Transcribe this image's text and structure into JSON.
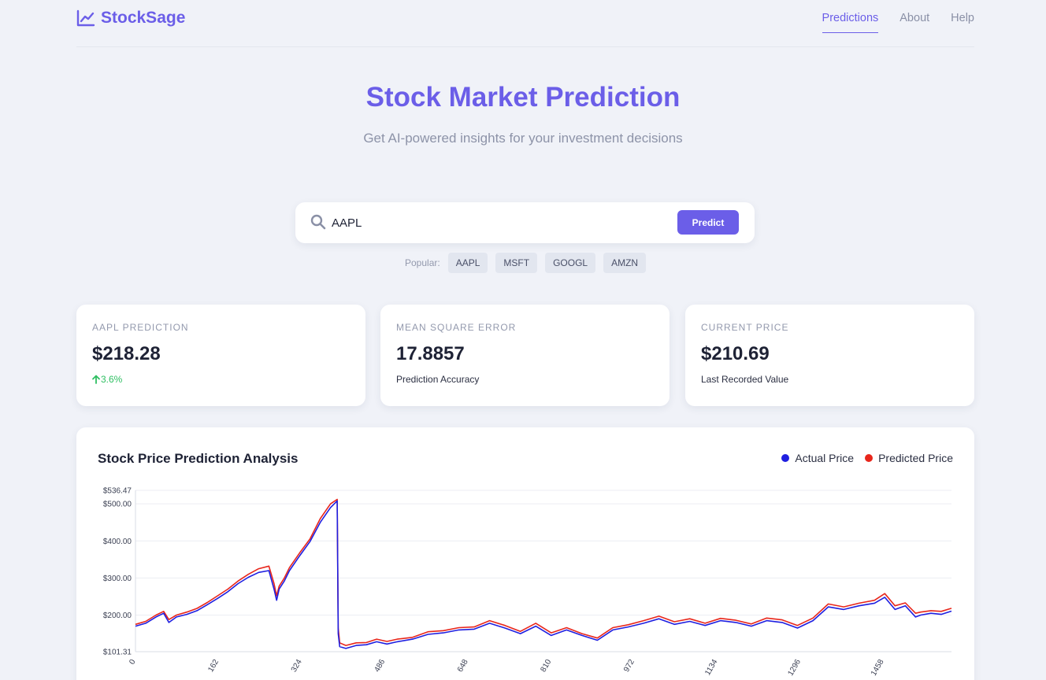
{
  "header": {
    "brand": "StockSage",
    "nav": [
      "Predictions",
      "About",
      "Help"
    ]
  },
  "hero": {
    "title": "Stock Market Prediction",
    "subtitle": "Get AI-powered insights for your investment decisions"
  },
  "search": {
    "value": "AAPL",
    "button": "Predict",
    "popular_label": "Popular:",
    "popular": [
      "AAPL",
      "MSFT",
      "GOOGL",
      "AMZN"
    ]
  },
  "cards": [
    {
      "label": "AAPL PREDICTION",
      "value": "$218.28",
      "note": "3.6%"
    },
    {
      "label": "MEAN SQUARE ERROR",
      "value": "17.8857",
      "note": "Prediction Accuracy"
    },
    {
      "label": "CURRENT PRICE",
      "value": "$210.69",
      "note": "Last Recorded Value"
    }
  ],
  "colors": {
    "accent": "#6b5ee8",
    "actual": "#1f1fe0",
    "predicted": "#e8261b",
    "up": "#2fbf62"
  },
  "chart_data": {
    "type": "line",
    "title": "Stock Price Prediction Analysis",
    "legend": [
      "Actual Price",
      "Predicted Price"
    ],
    "legend_position": "top-right",
    "ylim": [
      101.31,
      536.47
    ],
    "xlim": [
      0,
      1590
    ],
    "y_ticks": [
      101.31,
      200,
      300,
      400,
      500,
      536.47
    ],
    "y_tick_labels": [
      "$101.31",
      "$200.00",
      "$300.00",
      "$400.00",
      "$500.00",
      "$536.47"
    ],
    "x_ticks": [
      0,
      162,
      324,
      486,
      648,
      810,
      972,
      1134,
      1296,
      1458
    ],
    "grid": true,
    "series": [
      {
        "name": "Actual Price",
        "x": [
          0,
          20,
          40,
          55,
          65,
          80,
          100,
          120,
          140,
          160,
          180,
          200,
          220,
          240,
          260,
          270,
          275,
          280,
          290,
          300,
          320,
          340,
          360,
          380,
          393,
          395,
          398,
          410,
          430,
          450,
          470,
          490,
          510,
          540,
          570,
          600,
          630,
          660,
          690,
          720,
          750,
          780,
          810,
          840,
          870,
          900,
          930,
          960,
          990,
          1020,
          1050,
          1080,
          1110,
          1140,
          1170,
          1200,
          1230,
          1260,
          1290,
          1320,
          1350,
          1380,
          1410,
          1440,
          1460,
          1480,
          1500,
          1520,
          1530,
          1550,
          1570,
          1590
        ],
        "y": [
          170,
          178,
          195,
          205,
          180,
          195,
          202,
          212,
          228,
          245,
          263,
          285,
          302,
          315,
          320,
          270,
          240,
          270,
          292,
          320,
          360,
          398,
          450,
          490,
          508,
          150,
          115,
          110,
          118,
          120,
          128,
          122,
          128,
          135,
          148,
          152,
          160,
          162,
          178,
          165,
          150,
          170,
          145,
          160,
          145,
          132,
          160,
          168,
          178,
          190,
          175,
          183,
          172,
          185,
          180,
          170,
          185,
          180,
          165,
          185,
          222,
          215,
          225,
          232,
          248,
          215,
          225,
          195,
          200,
          205,
          202,
          210.69
        ]
      },
      {
        "name": "Predicted Price",
        "x": [
          0,
          20,
          40,
          55,
          65,
          80,
          100,
          120,
          140,
          160,
          180,
          200,
          220,
          240,
          260,
          270,
          275,
          280,
          290,
          300,
          320,
          340,
          360,
          380,
          393,
          395,
          398,
          410,
          430,
          450,
          470,
          490,
          510,
          540,
          570,
          600,
          630,
          660,
          690,
          720,
          750,
          780,
          810,
          840,
          870,
          900,
          930,
          960,
          990,
          1020,
          1050,
          1080,
          1110,
          1140,
          1170,
          1200,
          1230,
          1260,
          1290,
          1320,
          1350,
          1380,
          1410,
          1440,
          1460,
          1480,
          1500,
          1520,
          1530,
          1550,
          1570,
          1590
        ],
        "y": [
          175,
          183,
          200,
          210,
          188,
          200,
          208,
          218,
          234,
          252,
          270,
          292,
          310,
          325,
          332,
          285,
          252,
          278,
          300,
          328,
          368,
          405,
          460,
          500,
          512,
          165,
          125,
          118,
          125,
          126,
          135,
          129,
          135,
          140,
          155,
          158,
          166,
          168,
          185,
          172,
          156,
          178,
          152,
          166,
          150,
          138,
          166,
          174,
          185,
          197,
          182,
          190,
          178,
          191,
          186,
          176,
          192,
          187,
          172,
          192,
          230,
          222,
          232,
          240,
          258,
          225,
          233,
          205,
          208,
          212,
          210,
          218.28
        ]
      }
    ]
  }
}
